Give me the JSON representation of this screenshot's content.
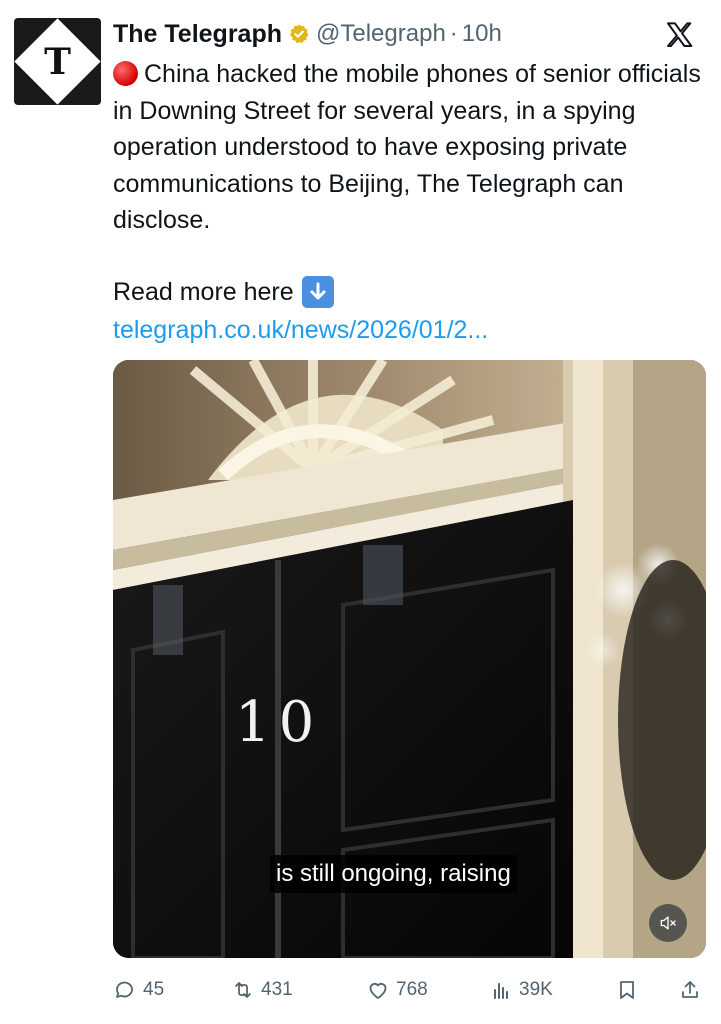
{
  "account": {
    "name": "The Telegraph",
    "handle": "@Telegraph",
    "separator": "·",
    "time": "10h",
    "avatar_letter": "T",
    "verified_color": "#e2b719"
  },
  "tweet": {
    "text_body": "China hacked the mobile phones of senior officials in Downing Street for several years, in a spying operation understood to have exposing private communications to Beijing, The Telegraph can disclose.",
    "read_more": "Read more here",
    "link": "telegraph.co.uk/news/2026/01/2..."
  },
  "media": {
    "door_number": "10",
    "caption": "is still ongoing, raising",
    "muted": true
  },
  "actions": {
    "replies": "45",
    "reposts": "431",
    "likes": "768",
    "views": "39K"
  },
  "colors": {
    "link": "#1d9bf0",
    "muted_text": "#536471",
    "text": "#0f1419"
  }
}
